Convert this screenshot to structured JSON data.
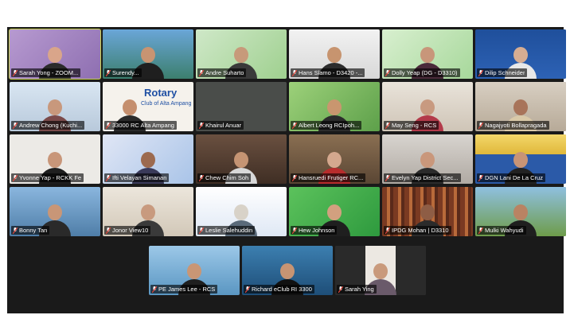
{
  "gallery": {
    "participants": [
      {
        "name": "Sarah Yong - ZOOM..."
      },
      {
        "name": "Surendy..."
      },
      {
        "name": "Andre Suharto"
      },
      {
        "name": "Hans Slamo - D3420 -..."
      },
      {
        "name": "Dolly Yeap (DG - D3310)"
      },
      {
        "name": "Dilip Schneider"
      },
      {
        "name": "Andrew Chong (Kuchi..."
      },
      {
        "name": "33000 RC Alta Ampang"
      },
      {
        "name": "Khairul Anuar"
      },
      {
        "name": "Albert Leong RCIpoh..."
      },
      {
        "name": "May Seng - RCS"
      },
      {
        "name": "Nagajyoti Bollapragada"
      },
      {
        "name": "Yvonne Yap - RCKK Fe"
      },
      {
        "name": "Ifti Velayan Simanan"
      },
      {
        "name": "Chew Chim Soh"
      },
      {
        "name": "Hansruedi Frutiger RC..."
      },
      {
        "name": "Evelyn Yap District Sec..."
      },
      {
        "name": "DGN Lani De La Cruz"
      },
      {
        "name": "Bonny Tan"
      },
      {
        "name": "Jonor View10"
      },
      {
        "name": "Leslie Salehuddin"
      },
      {
        "name": "Hew Johnson"
      },
      {
        "name": "IPDG Mohan | D3310"
      },
      {
        "name": "Mulki Wahyudi"
      },
      {
        "name": "PE James Lee - RCS"
      },
      {
        "name": "Richard eClub RI 3300"
      },
      {
        "name": "Sarah Ying"
      }
    ],
    "tile_text": {
      "rotary_logo": "Rotary",
      "rotary_club_line": "Club of Alta Ampang"
    }
  },
  "colors": {
    "active_border": "#c8d44a",
    "muted_mic": "#e0453a",
    "gallery_bg": "#1a1a1a"
  },
  "icons": [
    "muted-mic-icon"
  ]
}
